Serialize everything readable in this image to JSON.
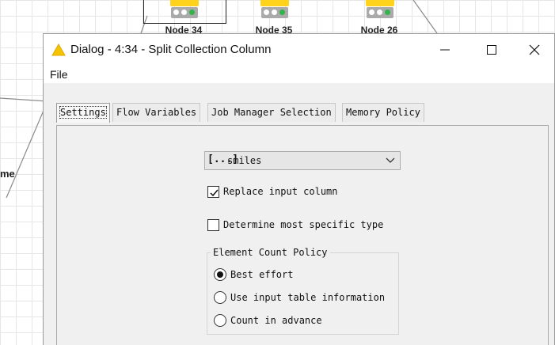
{
  "workflow": {
    "nodes": [
      {
        "label": "Node 34",
        "selected": true
      },
      {
        "label": "Node 35",
        "selected": false
      },
      {
        "label": "Node 26",
        "selected": false
      }
    ],
    "partial_node_label": "me"
  },
  "dialog": {
    "title": "Dialog - 4:34 - Split Collection Column",
    "title_icon": "warning-icon",
    "window_buttons": {
      "minimize": "—",
      "maximize": "☐",
      "close": "✕"
    },
    "menu": {
      "file": "File"
    },
    "tabs": [
      {
        "label": "Settings",
        "active": true
      },
      {
        "label": "Flow Variables",
        "active": false
      },
      {
        "label": "Job Manager Selection",
        "active": false
      },
      {
        "label": "Memory Policy",
        "active": false
      }
    ],
    "settings": {
      "column_select": {
        "type_icon": "[...]",
        "value": "smiles"
      },
      "replace_input_column": {
        "label": "Replace input column",
        "checked": true
      },
      "determine_specific_type": {
        "label": "Determine most specific type",
        "checked": false
      },
      "element_count_policy": {
        "legend": "Element Count Policy",
        "options": [
          {
            "label": "Best effort",
            "selected": true
          },
          {
            "label": "Use input table information",
            "selected": false
          },
          {
            "label": "Count in advance",
            "selected": false
          }
        ]
      }
    }
  },
  "colors": {
    "node_yellow": "#ffd21c",
    "status_green": "#32b44a",
    "warning_yellow": "#f5c400"
  }
}
